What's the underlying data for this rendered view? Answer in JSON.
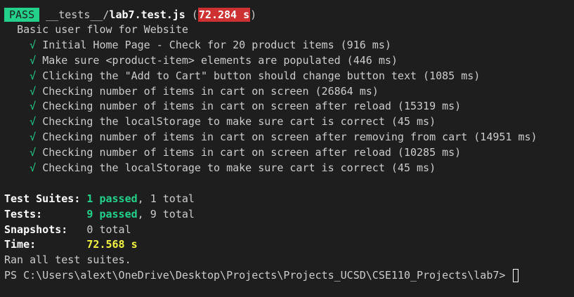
{
  "header": {
    "status": "PASS",
    "file_dim": "__tests__/",
    "file_name": "lab7.test.js",
    "open_paren": " (",
    "duration": "72.284 s",
    "close_paren": ")"
  },
  "suite": {
    "title": "Basic user flow for Website",
    "check_glyph": "√",
    "tests": [
      {
        "name": "Initial Home Page - Check for 20 product items (916 ms)"
      },
      {
        "name": "Make sure <product-item> elements are populated (446 ms)"
      },
      {
        "name": "Clicking the \"Add to Cart\" button should change button text (1085 ms)"
      },
      {
        "name": "Checking number of items in cart on screen (26864 ms)"
      },
      {
        "name": "Checking number of items in cart on screen after reload (15319 ms)"
      },
      {
        "name": "Checking the localStorage to make sure cart is correct (45 ms)"
      },
      {
        "name": "Checking number of items in cart on screen after removing from cart (14951 ms)"
      },
      {
        "name": "Checking number of items in cart on screen after reload (10285 ms)"
      },
      {
        "name": "Checking the localStorage to make sure cart is correct (45 ms)"
      }
    ]
  },
  "summary": {
    "suites_label": "Test Suites: ",
    "suites_passed": "1 passed",
    "suites_total": ", 1 total",
    "tests_label": "Tests:       ",
    "tests_passed": "9 passed",
    "tests_total": ", 9 total",
    "snapshots_label": "Snapshots:   ",
    "snapshots_total": "0 total",
    "time_label": "Time:        ",
    "time_value": "72.568 s",
    "ran_all": "Ran all test suites."
  },
  "prompt": {
    "text": "PS C:\\Users\\alext\\OneDrive\\Desktop\\Projects\\Projects_UCSD\\CSE110_Projects\\lab7> "
  },
  "colors": {
    "background": "#1e1e1e",
    "pass_green": "#23d18b",
    "duration_red": "#cd3131",
    "time_yellow": "#f5f543",
    "text": "#cccccc"
  }
}
